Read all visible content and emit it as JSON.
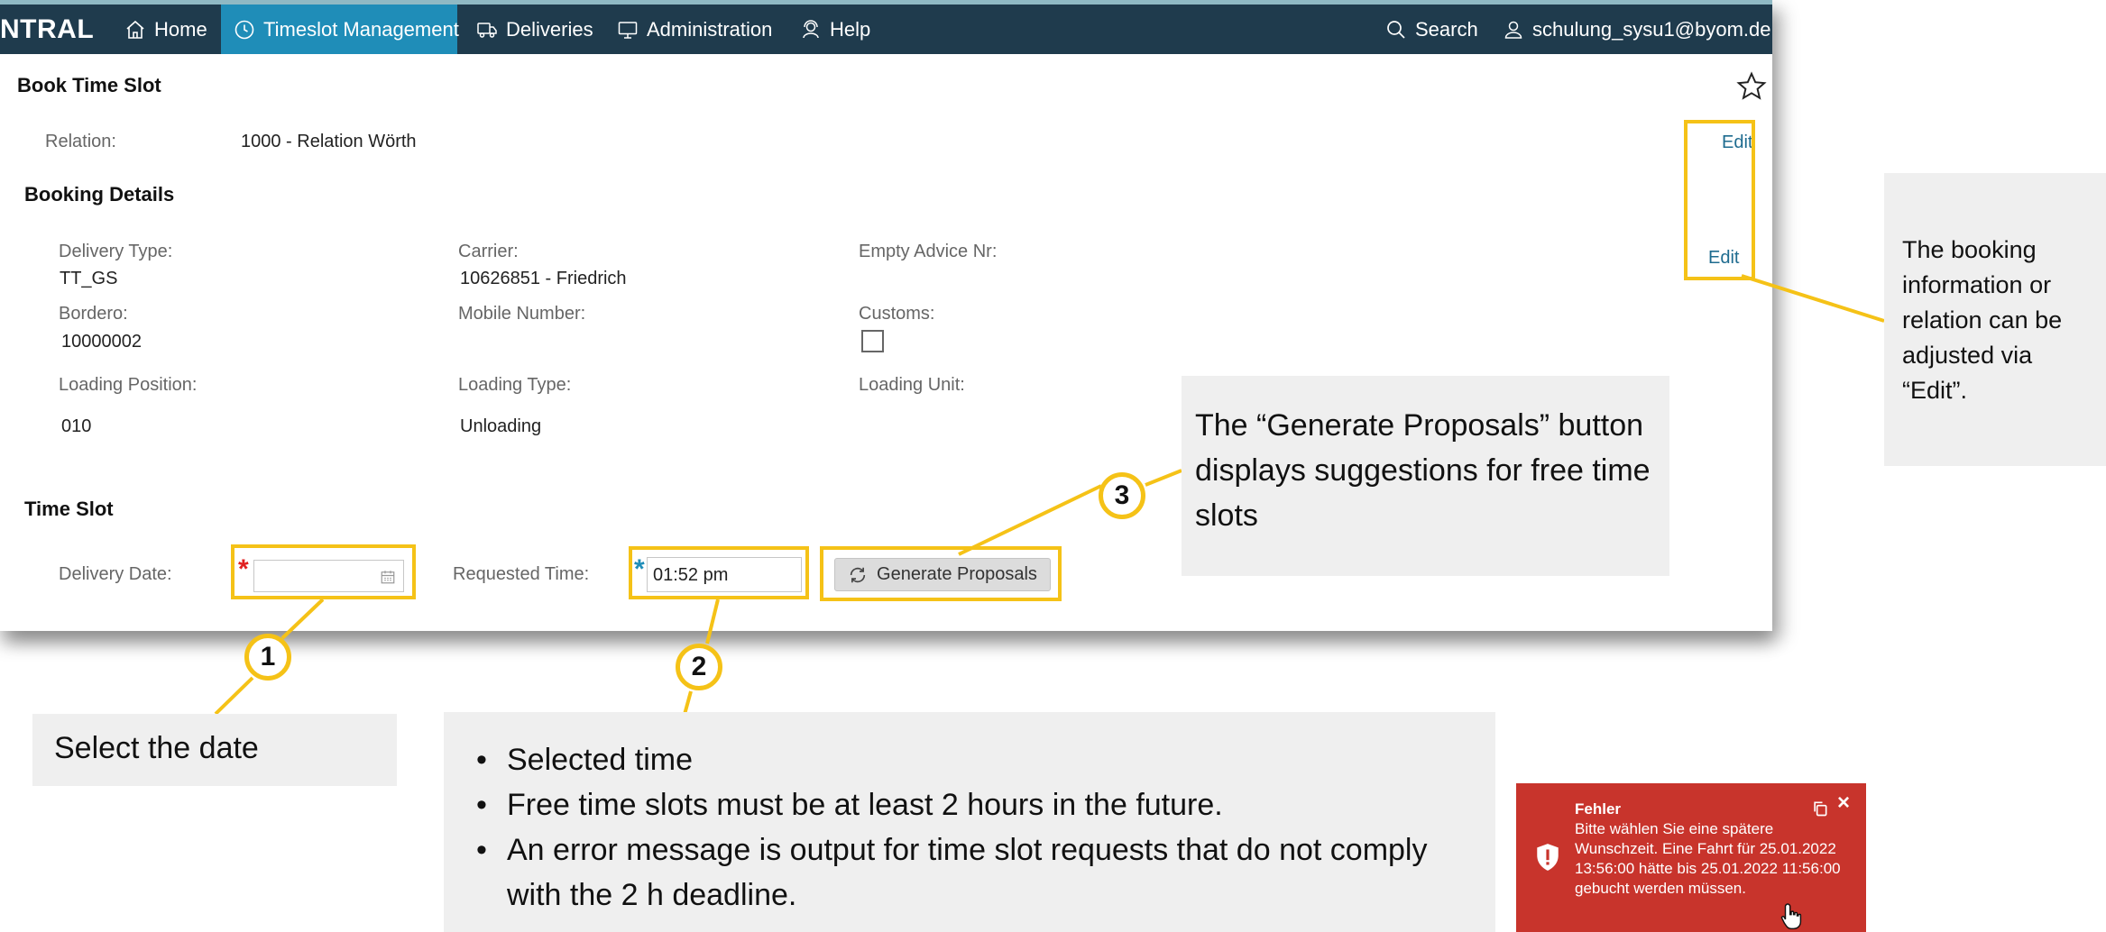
{
  "nav": {
    "brand": "NTRAL",
    "home": "Home",
    "timeslot": "Timeslot Management",
    "deliveries": "Deliveries",
    "administration": "Administration",
    "help": "Help",
    "search": "Search",
    "user": "schulung_sysu1@byom.de"
  },
  "book": {
    "title": "Book Time Slot",
    "relation_label": "Relation:",
    "relation_value": "1000 - Relation Wörth",
    "edit1": "Edit",
    "edit2": "Edit"
  },
  "details": {
    "title": "Booking Details",
    "delivery_type_label": "Delivery Type:",
    "delivery_type_value": "TT_GS",
    "carrier_label": "Carrier:",
    "carrier_value": "10626851 - Friedrich",
    "empty_advice_label": "Empty Advice Nr:",
    "bordero_label": "Bordero:",
    "bordero_value": "10000002",
    "mobile_label": "Mobile Number:",
    "customs_label": "Customs:",
    "customs_checked": false,
    "loading_position_label": "Loading Position:",
    "loading_position_value": "010",
    "loading_type_label": "Loading Type:",
    "loading_type_value": "Unloading",
    "loading_unit_label": "Loading Unit:"
  },
  "timeslot": {
    "title": "Time Slot",
    "delivery_date_label": "Delivery Date:",
    "delivery_date_value": "",
    "requested_time_label": "Requested Time:",
    "requested_time_value": "01:52 pm",
    "generate_label": "Generate Proposals"
  },
  "annotations": {
    "marker1": "1",
    "marker2": "2",
    "marker3": "3",
    "edit_note": "The booking information or relation can be adjusted via “Edit”.",
    "date_note": "Select the date",
    "time_bullets": [
      "Selected time",
      "Free time slots must be at least 2 hours in the future.",
      "An error message is output for time slot requests that do not comply with the 2 h deadline."
    ],
    "generate_note": "The “Generate Proposals” button displays suggestions for free time slots"
  },
  "toast": {
    "title": "Fehler",
    "message": "Bitte wählen Sie eine spätere Wunschzeit. Eine Fahrt für 25.01.2022 13:56:00 hätte bis 25.01.2022 11:56:00 gebucht werden müssen."
  },
  "colors": {
    "nav_bg": "#1f3b4d",
    "nav_active": "#1f8db8",
    "highlight": "#f5c217",
    "link": "#1e6b8f",
    "error_bg": "#c8342c",
    "required_red": "#e02020",
    "required_blue": "#1f8db8"
  }
}
